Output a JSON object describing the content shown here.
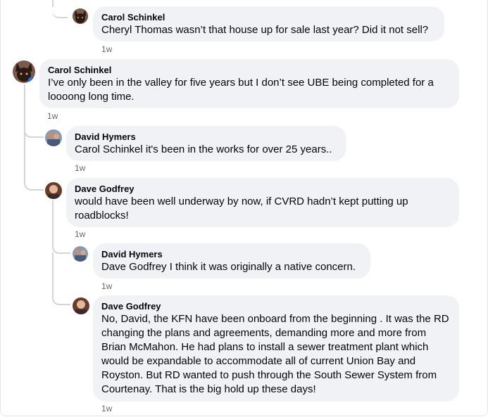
{
  "comments": [
    {
      "author": "Carol Schinkel",
      "text": "Cheryl Thomas wasn’t that house up for sale last year? Did it not sell?",
      "time": "1w"
    },
    {
      "author": "Carol Schinkel",
      "text": "I’ve only been in the valley for five years but I don’t see UBE being completed for a loooong long time.",
      "time": "1w"
    },
    {
      "author": "David Hymers",
      "text": "Carol Schinkel it's been in the works for over 25 years..",
      "time": "1w"
    },
    {
      "author": "Dave Godfrey",
      "text": "would have been well underway by now, if CVRD hadn’t kept putting up roadblocks!",
      "time": "1w"
    },
    {
      "author": "David Hymers",
      "text": "Dave Godfrey I think it was originally a native concern.",
      "time": "1w"
    },
    {
      "author": "Dave Godfrey",
      "text": "No, David, the KFN have been onboard from the beginning . It was the RD changing the plans and agreements, demanding more and more from Brian McMahon. He had plans to install a sewer treatment plant which would be expandable to accommodate all of current Union Bay and Royston. But RD wanted to push through the South Sewer System from Courtenay. That is the big hold up these days!",
      "time": "1w"
    }
  ],
  "avatars": {
    "carol": "cat-avatar",
    "david": "photo-avatar",
    "dave": "portrait-avatar"
  }
}
